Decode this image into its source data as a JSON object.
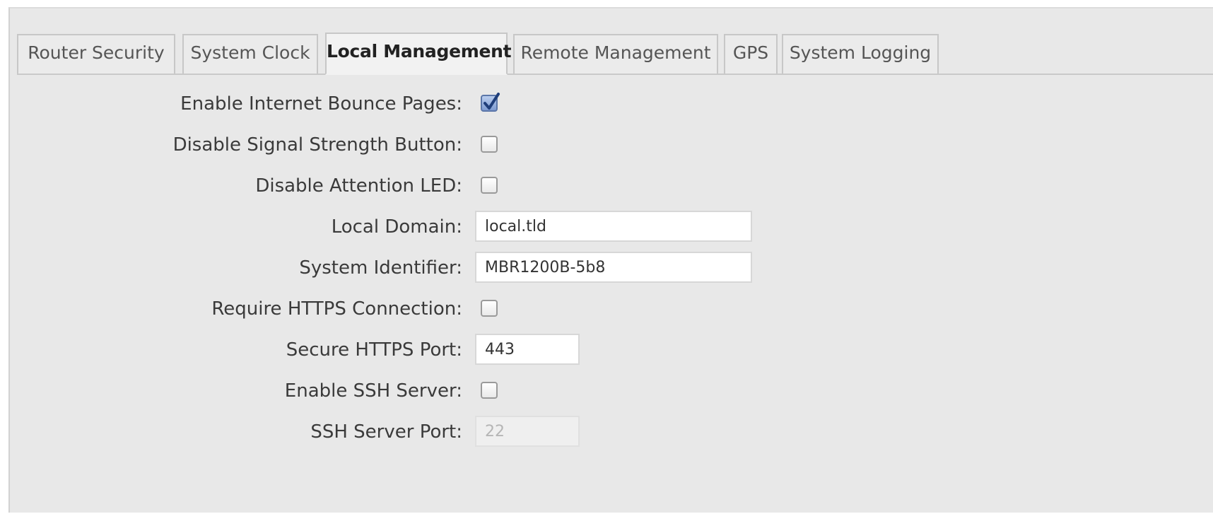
{
  "tabs": [
    {
      "label": "Router Security",
      "active": false
    },
    {
      "label": "System Clock",
      "active": false
    },
    {
      "label": "Local Management",
      "active": true
    },
    {
      "label": "Remote Management",
      "active": false
    },
    {
      "label": "GPS",
      "active": false
    },
    {
      "label": "System Logging",
      "active": false
    }
  ],
  "form": {
    "enable_bounce_pages": {
      "label": "Enable Internet Bounce Pages:",
      "checked": true
    },
    "disable_signal_button": {
      "label": "Disable Signal Strength Button:",
      "checked": false
    },
    "disable_attention_led": {
      "label": "Disable Attention LED:",
      "checked": false
    },
    "local_domain": {
      "label": "Local Domain:",
      "value": "local.tld"
    },
    "system_identifier": {
      "label": "System Identifier:",
      "value": "MBR1200B-5b8"
    },
    "require_https": {
      "label": "Require HTTPS Connection:",
      "checked": false
    },
    "secure_https_port": {
      "label": "Secure HTTPS Port:",
      "value": "443"
    },
    "enable_ssh": {
      "label": "Enable SSH Server:",
      "checked": false
    },
    "ssh_port": {
      "label": "SSH Server Port:",
      "value": "22",
      "disabled": true
    }
  },
  "colors": {
    "panel_bg": "#e8e8e8",
    "checkbox_checked": "#7e9bd1",
    "tab_border": "#c7c7c7"
  }
}
